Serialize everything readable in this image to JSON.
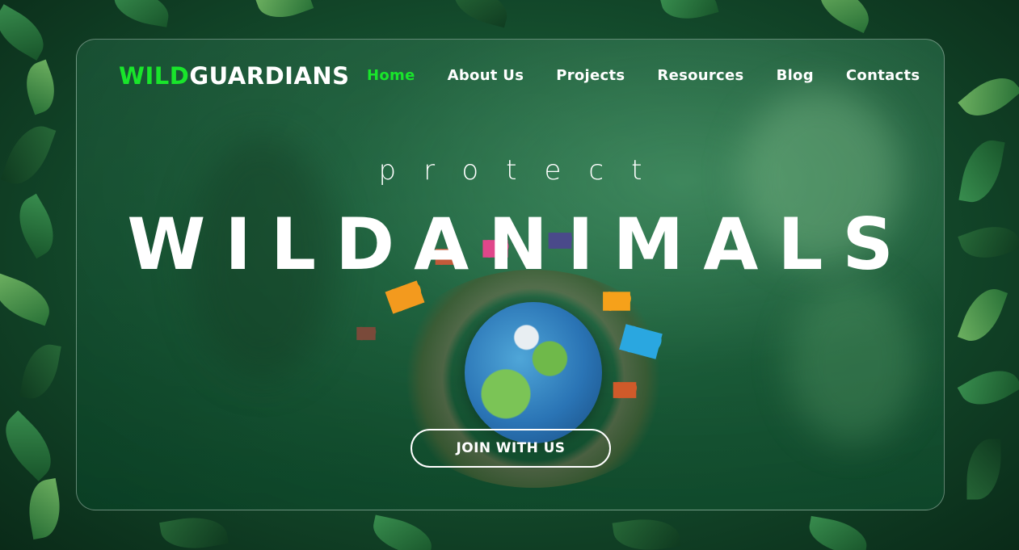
{
  "brand": {
    "prefix": "WILD",
    "suffix": "GUARDIANS",
    "accent_color": "#19e52b"
  },
  "nav": {
    "items": [
      {
        "label": "Home",
        "active": true
      },
      {
        "label": "About Us",
        "active": false
      },
      {
        "label": "Projects",
        "active": false
      },
      {
        "label": "Resources",
        "active": false
      },
      {
        "label": "Blog",
        "active": false
      },
      {
        "label": "Contacts",
        "active": false
      }
    ]
  },
  "hero": {
    "subtitle": "protect",
    "headline": "WILDANIMALS",
    "cta_label": "JOIN WITH US",
    "illustration": "globe-with-animals-and-butterflies"
  },
  "colors": {
    "text": "#ffffff",
    "active_nav": "#19e52b",
    "background": "#0b2a1a"
  }
}
